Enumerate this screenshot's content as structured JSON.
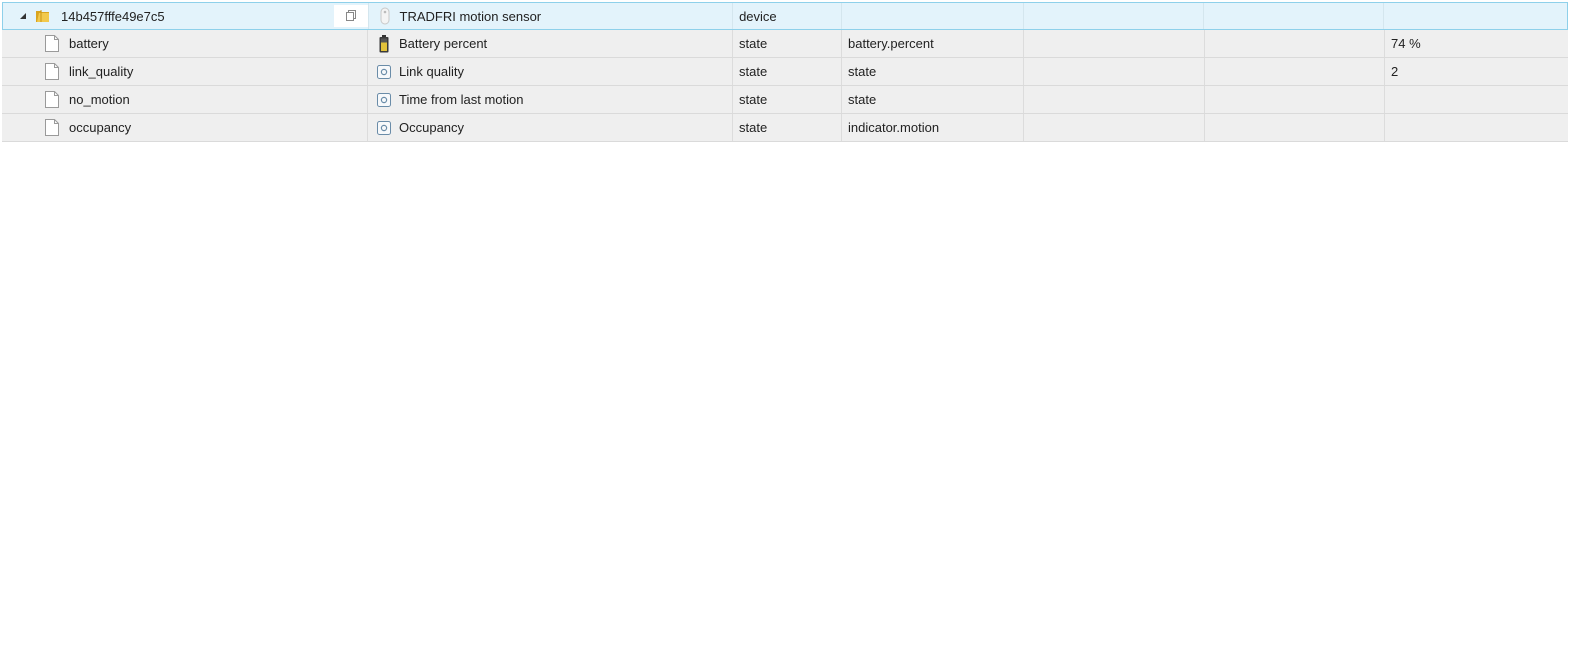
{
  "device": {
    "id": "14b457fffe49e7c5",
    "name": "TRADFRI motion sensor",
    "type": "device",
    "role": "",
    "room": "",
    "function": "",
    "value": "",
    "icon": "motion-sensor-icon",
    "expanded": true
  },
  "states": [
    {
      "id": "battery",
      "name": "Battery percent",
      "type": "state",
      "role": "battery.percent",
      "room": "",
      "function": "",
      "value": "74 %",
      "icon": "battery-icon"
    },
    {
      "id": "link_quality",
      "name": "Link quality",
      "type": "state",
      "role": "state",
      "room": "",
      "function": "",
      "value": "2",
      "icon": "state-icon"
    },
    {
      "id": "no_motion",
      "name": "Time from last motion",
      "type": "state",
      "role": "state",
      "room": "",
      "function": "",
      "value": "",
      "icon": "state-icon"
    },
    {
      "id": "occupancy",
      "name": "Occupancy",
      "type": "state",
      "role": "indicator.motion",
      "room": "",
      "function": "",
      "value": "",
      "icon": "state-icon"
    }
  ],
  "colors": {
    "device_row_bg": "#e3f3fb",
    "device_row_border": "#8ed0ea",
    "state_row_bg": "#efefef",
    "folder": "#e8b931"
  }
}
